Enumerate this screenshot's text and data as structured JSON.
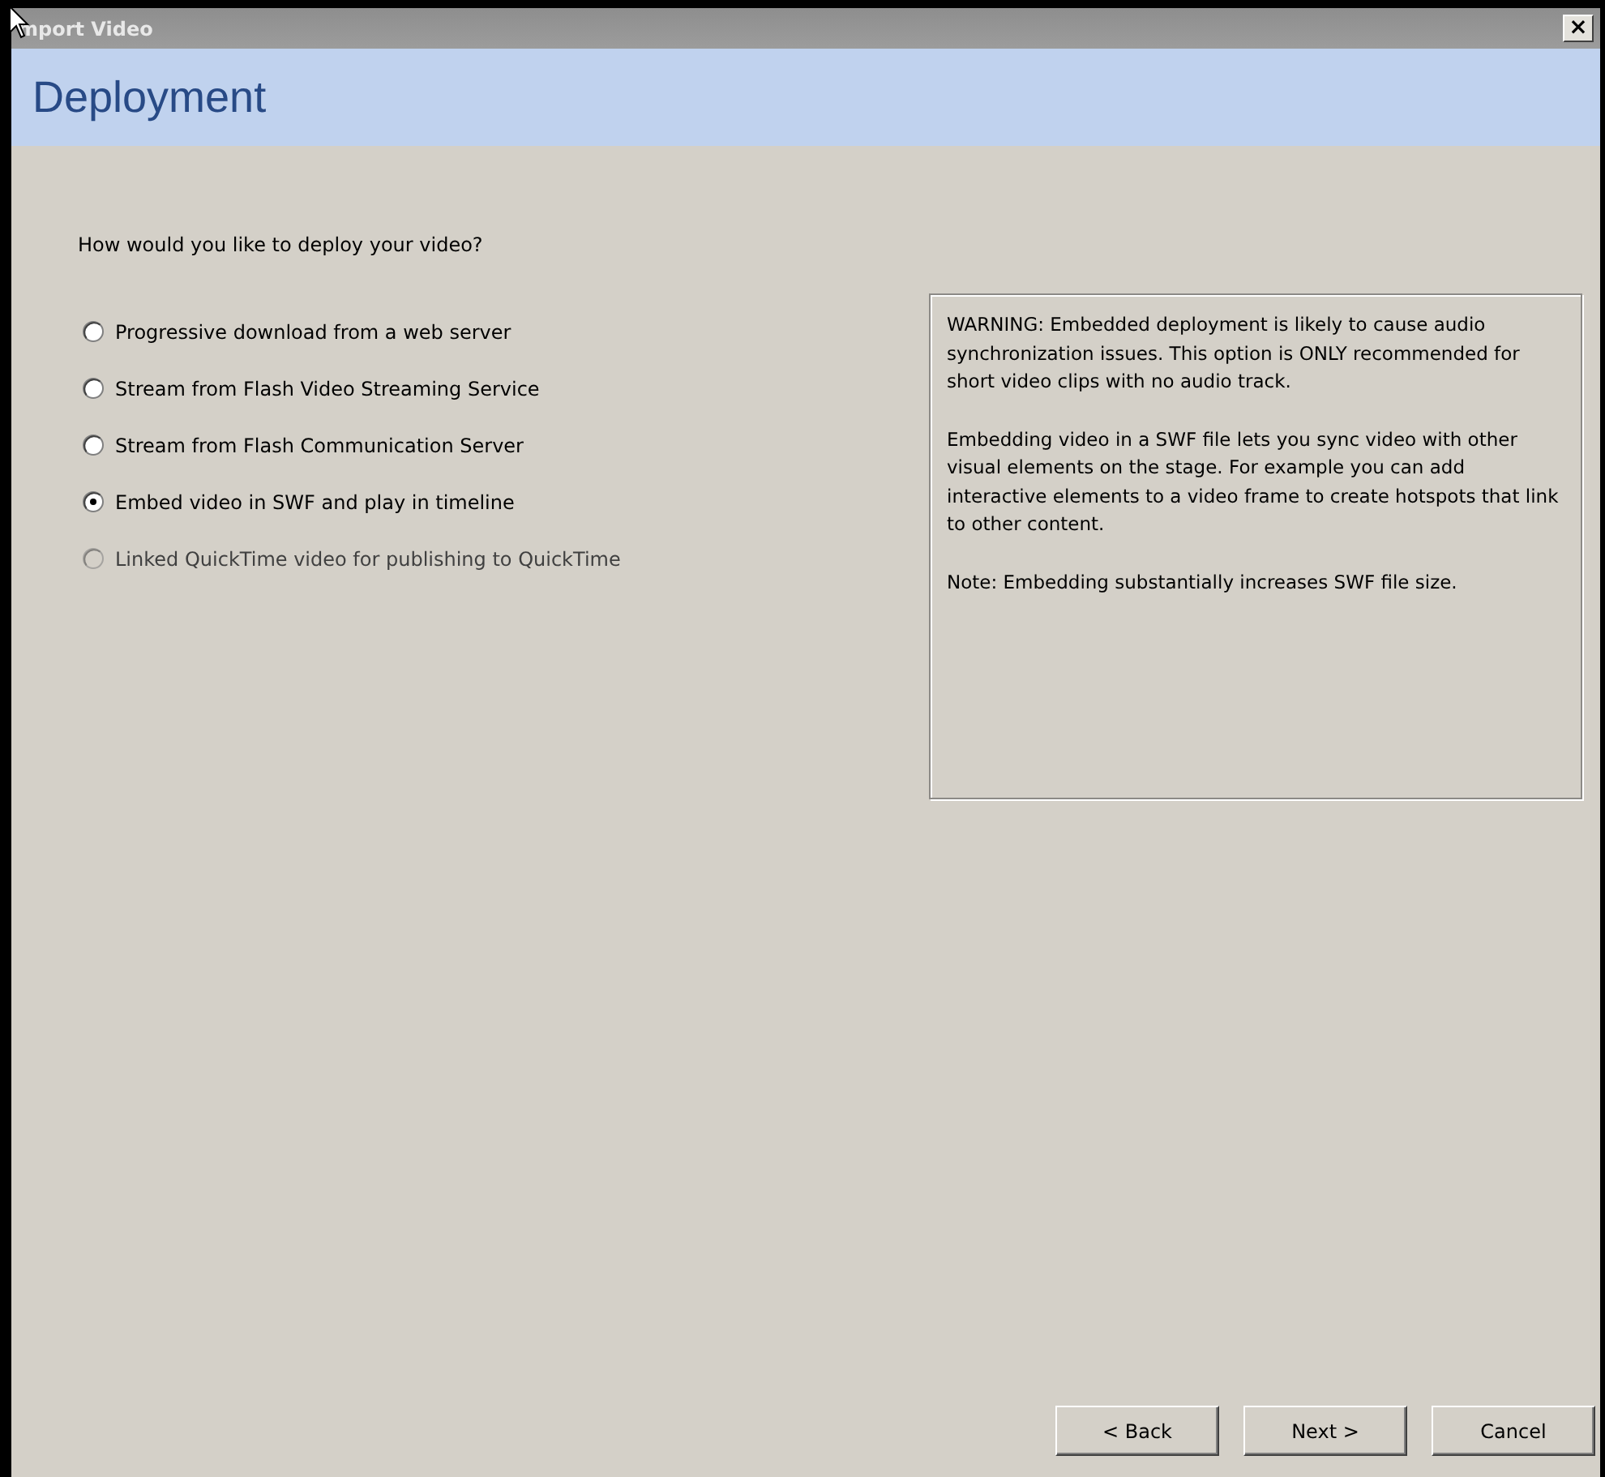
{
  "window": {
    "title": "mport Video",
    "close": "×"
  },
  "header": {
    "title": "Deployment"
  },
  "question": "How would you like to deploy your video?",
  "options": [
    {
      "label": "Progressive download from a web server",
      "selected": false,
      "disabled": false
    },
    {
      "label": "Stream from Flash Video Streaming Service",
      "selected": false,
      "disabled": false
    },
    {
      "label": "Stream from Flash Communication Server",
      "selected": false,
      "disabled": false
    },
    {
      "label": "Embed video in SWF and play in timeline",
      "selected": true,
      "disabled": false
    },
    {
      "label": "Linked QuickTime video for publishing to QuickTime",
      "selected": false,
      "disabled": true
    }
  ],
  "info": [
    "WARNING: Embedded deployment is likely to cause audio synchronization issues. This option is ONLY recommended for short video clips with no audio track.",
    "Embedding video in a SWF file lets you sync video with other visual elements on the stage. For example you can add interactive elements to a video frame to create hotspots that link to other content.",
    "Note: Embedding substantially increases SWF file size."
  ],
  "buttons": [
    "< Back",
    "Next >",
    "Cancel"
  ]
}
